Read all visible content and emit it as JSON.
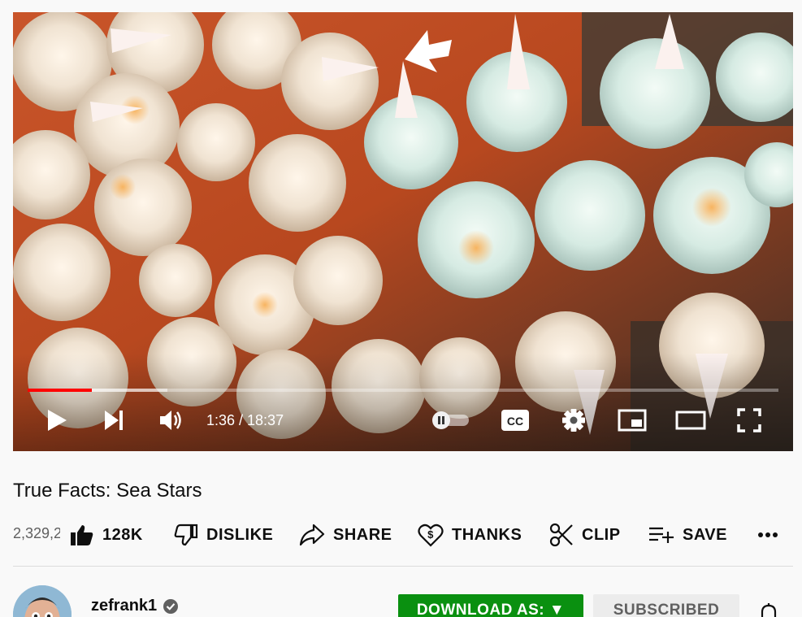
{
  "video": {
    "current_time": "1:36 / 18:37",
    "played_fraction": 0.086,
    "buffered_fraction": 0.186,
    "autoplay_on": false
  },
  "player_icons": [
    "play-icon",
    "next-icon",
    "volume-icon",
    "autoplay-toggle-icon",
    "captions-icon",
    "settings-icon",
    "miniplayer-icon",
    "theater-mode-icon",
    "fullscreen-icon"
  ],
  "title": "True Facts: Sea Stars",
  "views": "2,329,2",
  "actions": {
    "like": "128K",
    "dislike": "DISLIKE",
    "share": "SHARE",
    "thanks": "THANKS",
    "clip": "CLIP",
    "save": "SAVE"
  },
  "channel": {
    "name": "zefrank1",
    "verified": true
  },
  "buttons": {
    "download": "DOWNLOAD AS: ▼",
    "subscribe": "SUBSCRIBED"
  },
  "colors": {
    "progress_played": "#ff0000",
    "download_button": "#0a9010",
    "subscribed_button": "#ececec"
  }
}
